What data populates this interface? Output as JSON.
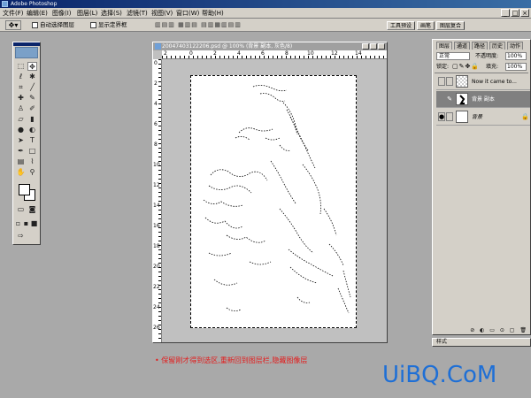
{
  "app": {
    "title": "Adobe Photoshop"
  },
  "menubar": {
    "items": [
      "文件(F)",
      "编辑(E)",
      "图像(I)",
      "图层(L)",
      "选择(S)",
      "滤镜(T)",
      "视图(V)",
      "窗口(W)",
      "帮助(H)"
    ],
    "window_buttons": [
      "_",
      "□",
      "×"
    ]
  },
  "options_bar": {
    "auto_select_layer": "自动选择图层",
    "show_bounding_box": "显示定界框",
    "wells": [
      "工具预设",
      "画笔",
      "图层复合"
    ]
  },
  "document": {
    "title": "20047403122206.psd @ 100% (背景 副本, 灰色/8)",
    "ruler_top": [
      "2",
      "0",
      "2",
      "4",
      "6",
      "8",
      "10",
      "12",
      "14"
    ],
    "ruler_left": [
      "0",
      "2",
      "4",
      "6",
      "8",
      "10",
      "12",
      "14",
      "16",
      "18",
      "20",
      "22",
      "24",
      "26"
    ]
  },
  "layers_panel": {
    "tabs": [
      "图层",
      "通道",
      "路径",
      "历史",
      "动作"
    ],
    "blend_mode": "正常",
    "opacity_label": "不透明度:",
    "opacity_value": "100%",
    "lock_label": "锁定:",
    "fill_label": "填充:",
    "fill_value": "100%",
    "layers": [
      {
        "name": "Now it came to...",
        "visible": false,
        "selected": false
      },
      {
        "name": "背景 副本",
        "visible": false,
        "selected": true
      },
      {
        "name": "背景",
        "visible": true,
        "selected": false
      }
    ]
  },
  "actions_bar": {
    "label": "样式"
  },
  "caption": "• 保留刚才得到选区,重新回到图层栏,隐藏图像层",
  "watermark": "UiBQ.CoM"
}
